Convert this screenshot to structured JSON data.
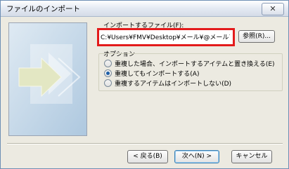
{
  "window": {
    "title": "ファイルのインポート",
    "close_glyph": "✕"
  },
  "file": {
    "label": "インポートするファイル(F):",
    "value": "C:¥Users¥FMV¥Desktop¥メール¥@メールアドレ",
    "browse_label": "参照(R)..."
  },
  "options": {
    "label": "オプション",
    "items": [
      {
        "label": "重複した場合、インポートするアイテムと置き換える(E)",
        "selected": false
      },
      {
        "label": "重複してもインポートする(A)",
        "selected": true
      },
      {
        "label": "重複するアイテムはインポートしない(D)",
        "selected": false
      }
    ]
  },
  "buttons": {
    "back": "< 戻る(B)",
    "next": "次へ(N) >",
    "cancel": "キャンセル"
  },
  "colors": {
    "highlight": "#e31b1b",
    "art_bg": "#c9dbea"
  }
}
